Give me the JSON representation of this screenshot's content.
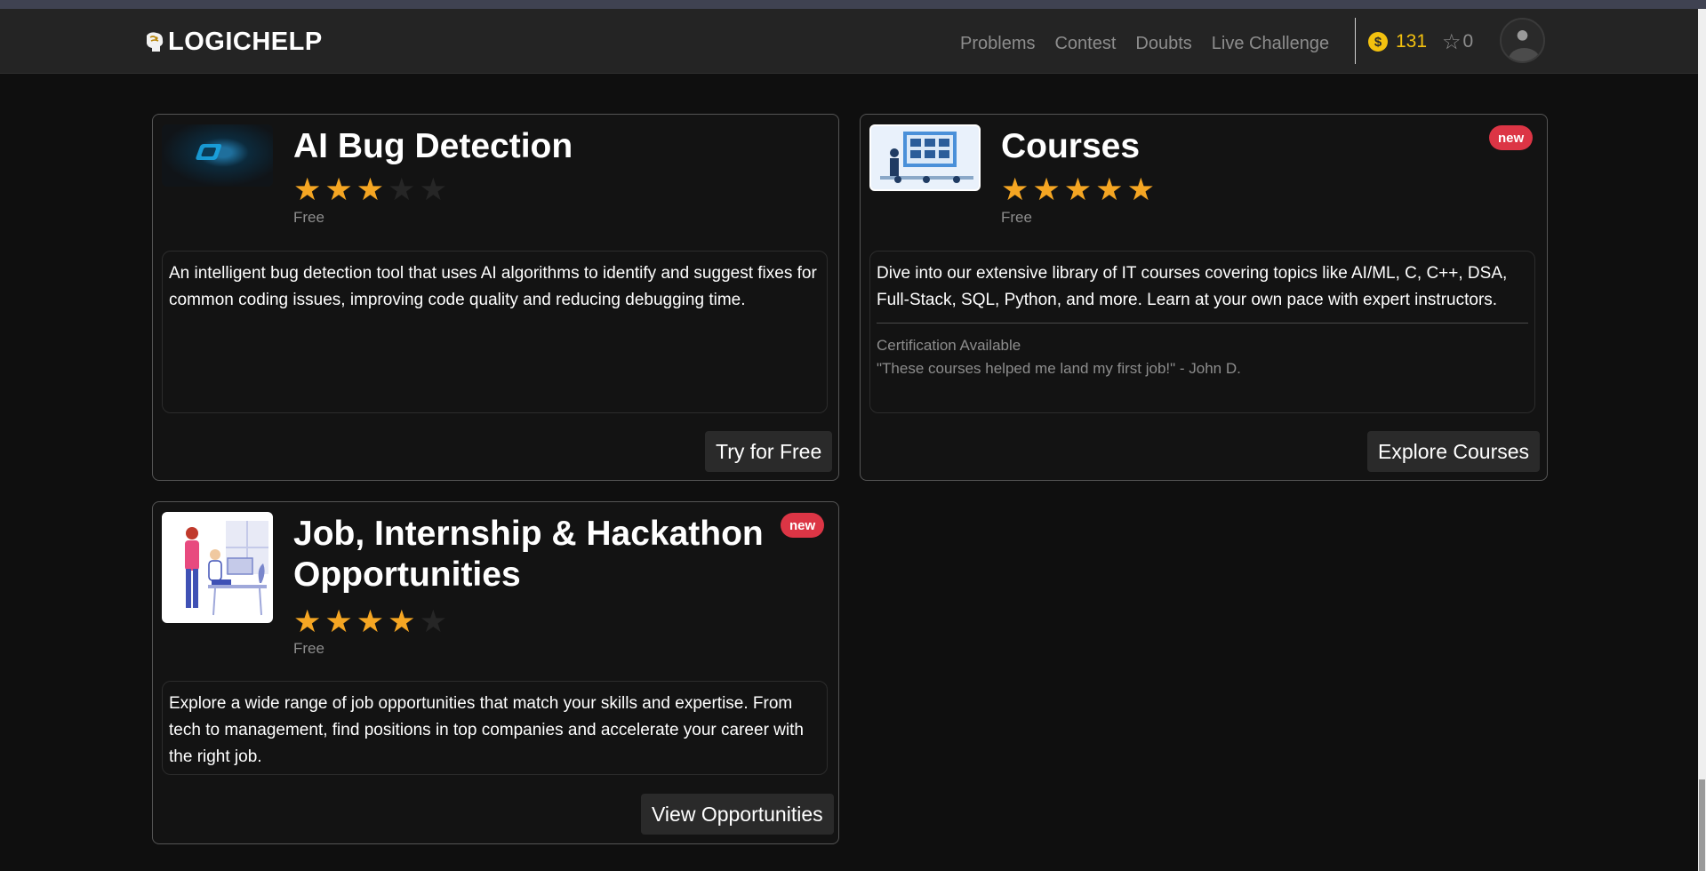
{
  "nav": {
    "logo": "LOGICHELP",
    "links": [
      "Problems",
      "Contest",
      "Doubts",
      "Live Challenge"
    ],
    "coin_icon": "$",
    "coins": "131",
    "stars": "0"
  },
  "cards": [
    {
      "title": "AI Bug Detection",
      "rating": 3,
      "rating_max": 5,
      "price": "Free",
      "badge": "",
      "description": "An intelligent bug detection tool that uses AI algorithms to identify and suggest fixes for common coding issues, improving code quality and reducing debugging time.",
      "button": "Try for Free"
    },
    {
      "title": "Courses",
      "rating": 5,
      "rating_max": 5,
      "price": "Free",
      "badge": "new",
      "description": "Dive into our extensive library of IT courses covering topics like AI/ML, C, C++, DSA, Full-Stack, SQL, Python, and more. Learn at your own pace with expert instructors.",
      "certification": "Certification Available",
      "testimonial": "\"These courses helped me land my first job!\" - John D.",
      "button": "Explore Courses"
    },
    {
      "title": "Job, Internship & Hackathon Opportunities",
      "rating": 4,
      "rating_max": 5,
      "price": "Free",
      "badge": "new",
      "description": "Explore a wide range of job opportunities that match your skills and expertise. From tech to management, find positions in top companies and accelerate your career with the right job.",
      "button": "View Opportunities"
    }
  ],
  "colors": {
    "accent": "#f3c10f",
    "star": "#f5a623",
    "badge": "#dc3545",
    "background": "#0f0f0f"
  }
}
